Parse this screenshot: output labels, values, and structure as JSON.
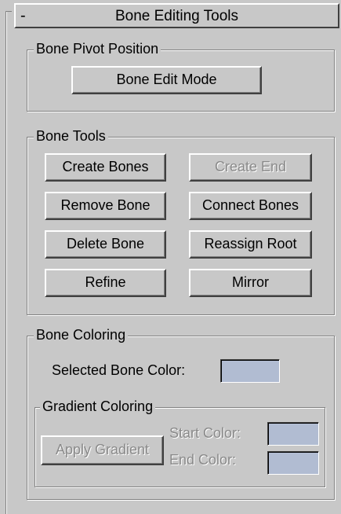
{
  "rollout": {
    "collapse_symbol": "-",
    "title": "Bone Editing Tools"
  },
  "pivot_group": {
    "title": "Bone Pivot Position",
    "edit_mode_label": "Bone Edit Mode"
  },
  "tools_group": {
    "title": "Bone Tools",
    "create_bones_label": "Create Bones",
    "create_end_label": "Create End",
    "remove_bone_label": "Remove Bone",
    "connect_bones_label": "Connect Bones",
    "delete_bone_label": "Delete Bone",
    "reassign_root_label": "Reassign Root",
    "refine_label": "Refine",
    "mirror_label": "Mirror"
  },
  "coloring_group": {
    "title": "Bone Coloring",
    "selected_color_label": "Selected Bone Color:",
    "selected_color": "#b1bcd2",
    "gradient": {
      "title": "Gradient Coloring",
      "apply_label": "Apply Gradient",
      "start_label": "Start Color:",
      "end_label": "End Color:",
      "start_color": "#b1bcd2",
      "end_color": "#b1bcd2"
    }
  }
}
